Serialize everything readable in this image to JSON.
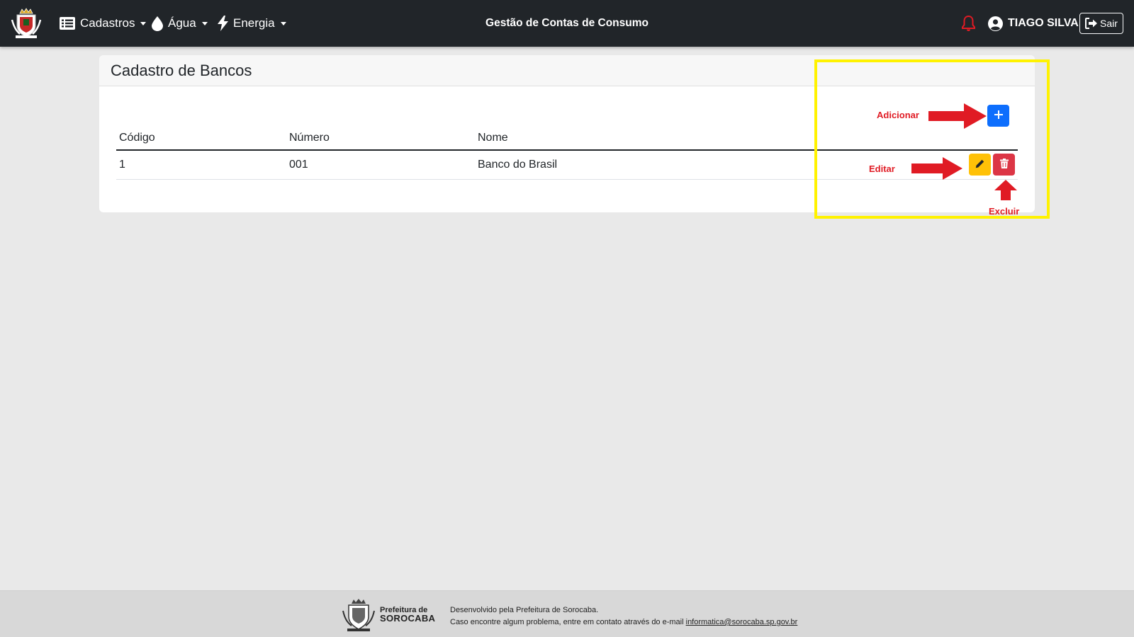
{
  "navbar": {
    "brand_logo_icon": "city-coat-of-arms-icon",
    "menus": [
      {
        "label": "Cadastros",
        "icon": "list-icon"
      },
      {
        "label": "Água",
        "icon": "droplet-icon"
      },
      {
        "label": "Energia",
        "icon": "lightning-icon"
      }
    ],
    "title": "Gestão de Contas de Consumo",
    "notification_icon": "bell-icon",
    "user_name": "TIAGO SILVA",
    "logout_label": "Sair"
  },
  "card": {
    "title": "Cadastro de Bancos",
    "add_button_icon": "plus-icon",
    "table": {
      "headers": [
        "Código",
        "Número",
        "Nome"
      ],
      "rows": [
        {
          "codigo": "1",
          "numero": "001",
          "nome": "Banco do Brasil"
        }
      ]
    }
  },
  "annotations": {
    "add_label": "Adicionar",
    "edit_label": "Editar",
    "delete_label": "Excluir",
    "highlight_color": "#fff200",
    "arrow_color": "#e01b24"
  },
  "footer": {
    "brand_line1": "Prefeitura de",
    "brand_line2": "SOROCABA",
    "developed_by": "Desenvolvido pela Prefeitura de Sorocaba.",
    "contact_text": "Caso encontre algum problema, entre em contato através do e-mail",
    "contact_email": "informatica@sorocaba.sp.gov.br"
  },
  "colors": {
    "navbar_bg": "#212529",
    "primary": "#0d6efd",
    "warning": "#ffc107",
    "danger": "#dc3545",
    "page_bg": "#e9e9e9"
  }
}
